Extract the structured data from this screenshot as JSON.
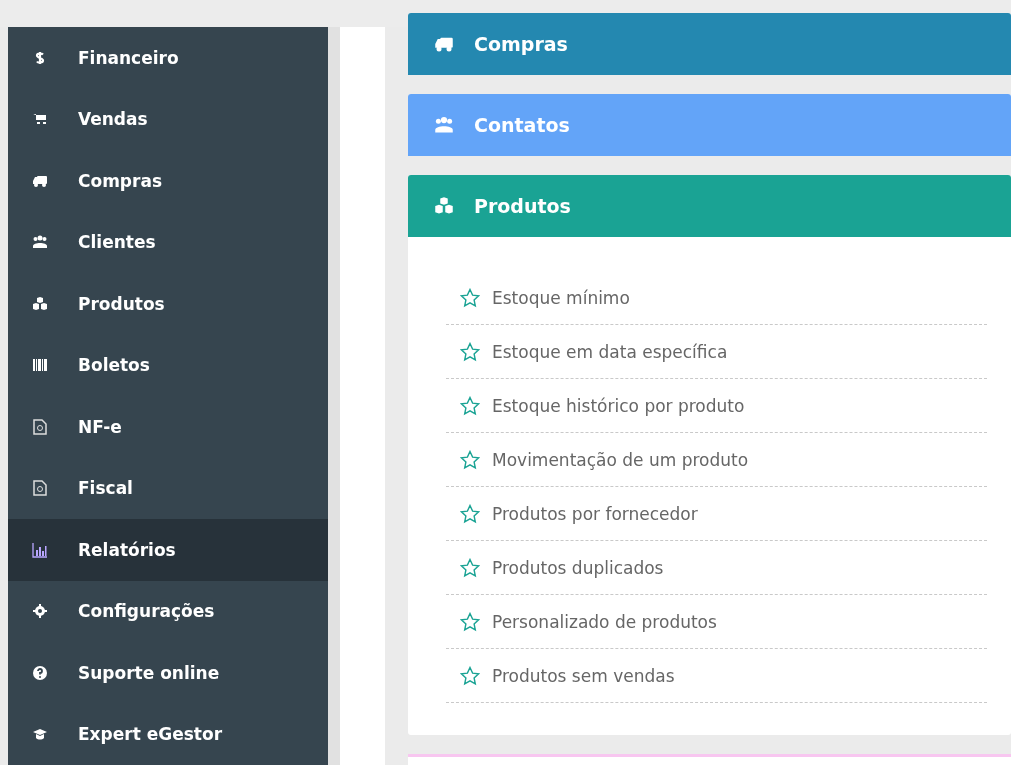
{
  "sidebar": {
    "items": [
      {
        "label": "Financeiro",
        "selected": false
      },
      {
        "label": "Vendas",
        "selected": false
      },
      {
        "label": "Compras",
        "selected": false
      },
      {
        "label": "Clientes",
        "selected": false
      },
      {
        "label": "Produtos",
        "selected": false
      },
      {
        "label": "Boletos",
        "selected": false
      },
      {
        "label": "NF-e",
        "selected": false
      },
      {
        "label": "Fiscal",
        "selected": false
      },
      {
        "label": "Relatórios",
        "selected": true
      },
      {
        "label": "Configurações",
        "selected": false
      },
      {
        "label": "Suporte online",
        "selected": false
      },
      {
        "label": "Expert eGestor",
        "selected": false
      }
    ]
  },
  "panels": [
    {
      "title": "Compras",
      "color": "#2488b0",
      "expanded": false
    },
    {
      "title": "Contatos",
      "color": "#63a4f8",
      "expanded": false
    },
    {
      "title": "Produtos",
      "color": "#1aa394",
      "expanded": true,
      "items": [
        {
          "label": "Estoque mínimo",
          "starred": false
        },
        {
          "label": "Estoque em data específica",
          "starred": false
        },
        {
          "label": "Estoque histórico por produto",
          "starred": false
        },
        {
          "label": "Movimentação de um produto",
          "starred": false
        },
        {
          "label": "Produtos por fornecedor",
          "starred": false
        },
        {
          "label": "Produtos duplicados",
          "starred": false
        },
        {
          "label": "Personalizado de produtos",
          "starred": false
        },
        {
          "label": "Produtos sem vendas",
          "starred": false
        }
      ]
    }
  ]
}
